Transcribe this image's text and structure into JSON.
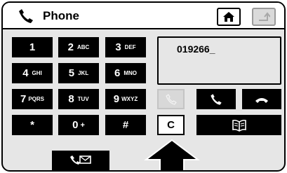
{
  "header": {
    "title": "Phone",
    "home_icon": "home-icon",
    "back_icon": "back-arrow-icon"
  },
  "keypad": [
    {
      "num": "1",
      "letters": ""
    },
    {
      "num": "2",
      "letters": "ABC"
    },
    {
      "num": "3",
      "letters": "DEF"
    },
    {
      "num": "4",
      "letters": "GHI"
    },
    {
      "num": "5",
      "letters": "JKL"
    },
    {
      "num": "6",
      "letters": "MNO"
    },
    {
      "num": "7",
      "letters": "PQRS"
    },
    {
      "num": "8",
      "letters": "TUV"
    },
    {
      "num": "9",
      "letters": "WXYZ"
    },
    {
      "num": "*",
      "letters": ""
    },
    {
      "num": "0",
      "letters": "+"
    },
    {
      "num": "#",
      "letters": ""
    }
  ],
  "display": {
    "number": "019266_"
  },
  "controls": {
    "redial_icon": "handset-icon",
    "call_icon": "call-icon",
    "hangup_icon": "hang-up-icon",
    "clear_label": "C",
    "phonebook_icon": "phonebook-icon",
    "voicemail_icon": "voicemail-icon"
  },
  "colors": {
    "background": "#e6e6e6",
    "key": "#000000",
    "disabled": "#d8d8d8",
    "header": "#ffffff"
  }
}
